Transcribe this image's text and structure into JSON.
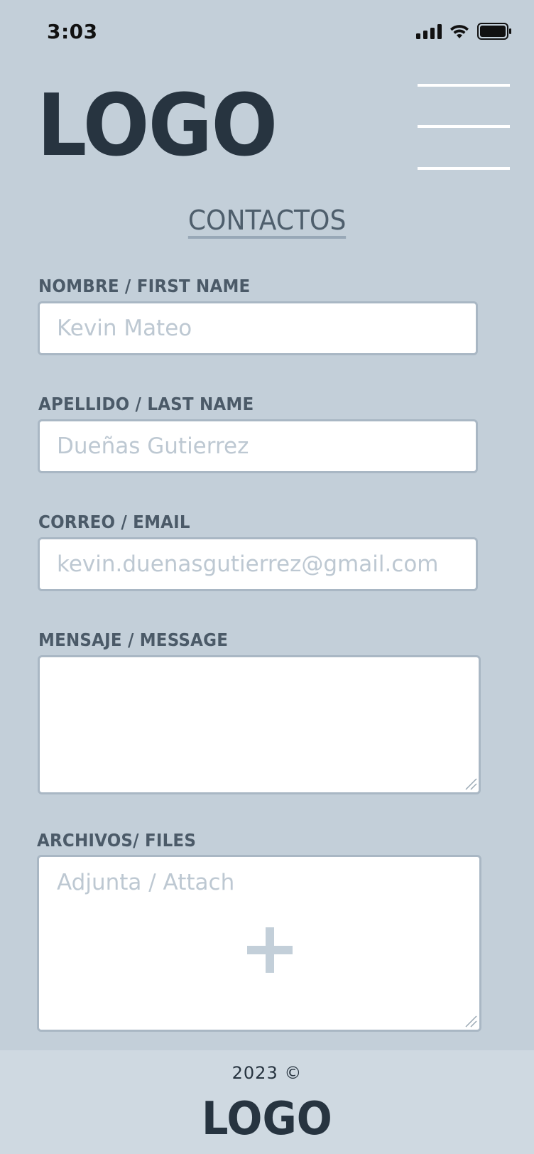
{
  "status_bar": {
    "time": "3:03",
    "icons": [
      "signal-icon",
      "wifi-icon",
      "battery-icon"
    ]
  },
  "header": {
    "logo_text": "LOGO",
    "menu_icon": "hamburger-menu-icon"
  },
  "page": {
    "title": "CONTACTOS"
  },
  "form": {
    "first_name": {
      "label": "NOMBRE / FIRST NAME",
      "placeholder": "Kevin Mateo",
      "value": ""
    },
    "last_name": {
      "label": "APELLIDO / LAST NAME",
      "placeholder": "Dueñas Gutierrez",
      "value": ""
    },
    "email": {
      "label": "CORREO / EMAIL",
      "placeholder": "kevin.duenasgutierrez@gmail.com",
      "value": ""
    },
    "message": {
      "label": "MENSAJE / MESSAGE",
      "value": ""
    },
    "files": {
      "label": "ARCHIVOS/ FILES",
      "placeholder": "Adjunta / Attach",
      "icon": "plus-icon"
    }
  },
  "footer": {
    "copyright": "2023 ©",
    "logo_text": "LOGO"
  },
  "colors": {
    "background": "#c3cfd9",
    "footer_background": "#cfd9e1",
    "logo": "#273440",
    "label": "#4b5a68",
    "placeholder": "#bdc8d2",
    "input_border": "#a9b7c4"
  }
}
